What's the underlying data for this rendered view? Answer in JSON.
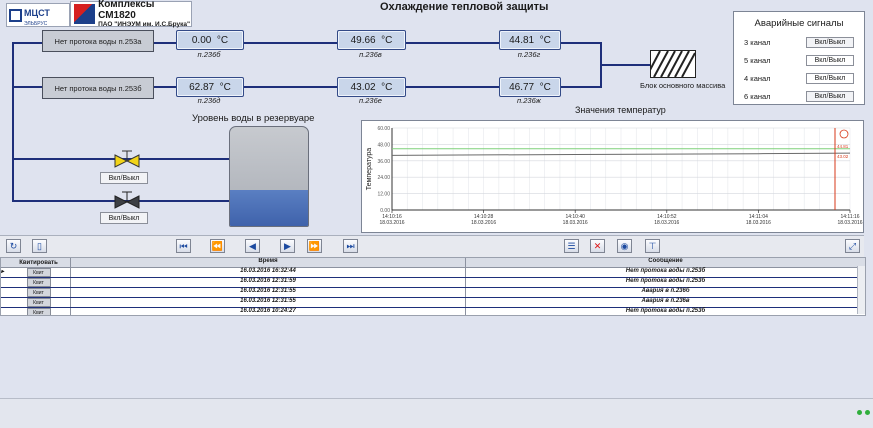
{
  "header": {
    "logo1_main": "МЦСТ",
    "logo1_sub": "ЭЛЬБРУС",
    "logo2_title": "Комплексы СМ1820",
    "logo2_sub": "ПАО \"ИНЭУМ им. И.С.Брука\"",
    "page_title": "Охлаждение тепловой защиты"
  },
  "process": {
    "flow1_label": "Нет протока воды п.253а",
    "flow2_label": "Нет протока воды п.253б",
    "sensors": [
      {
        "value": "0.00",
        "unit": "°C",
        "tag": "п.236б"
      },
      {
        "value": "49.66",
        "unit": "°C",
        "tag": "п.236в"
      },
      {
        "value": "44.81",
        "unit": "°C",
        "tag": "п.236г"
      },
      {
        "value": "62.87",
        "unit": "°C",
        "tag": "п.236д"
      },
      {
        "value": "43.02",
        "unit": "°C",
        "tag": "п.236е"
      },
      {
        "value": "46.77",
        "unit": "°C",
        "tag": "п.236ж"
      }
    ],
    "block_label": "Блок основного массива",
    "valve1_button": "Вкл/Выкл",
    "valve2_button": "Вкл/Выкл",
    "tank_title": "Уровень воды в резервуаре",
    "tank_level_fraction": 0.36
  },
  "alarms": {
    "title": "Аварийные сигналы",
    "rows": [
      {
        "label": "3 канал",
        "button": "Вкл/Выкл"
      },
      {
        "label": "5 канал",
        "button": "Вкл/Выкл"
      },
      {
        "label": "4 канал",
        "button": "Вкл/Выкл"
      },
      {
        "label": "6 канал",
        "button": "Вкл/Выкл"
      }
    ]
  },
  "chart_data": {
    "type": "line",
    "title": "Значения температур",
    "ylabel": "Температура",
    "ylim": [
      0,
      60
    ],
    "yticks": [
      "60.00",
      "48.00",
      "36.00",
      "24.00",
      "12.00",
      "0.00"
    ],
    "xticks": [
      {
        "time": "14:10:16",
        "date": "18.03.2016"
      },
      {
        "time": "14:10:28",
        "date": "18.03.2016"
      },
      {
        "time": "14:10:40",
        "date": "18.03.2016"
      },
      {
        "time": "14:10:52",
        "date": "18.03.2016"
      },
      {
        "time": "14:11:04",
        "date": "18.03.2016"
      },
      {
        "time": "14:11:16",
        "date": "18.03.2016"
      }
    ],
    "series": [
      {
        "color": "#7fd07a",
        "values": [
          44.8,
          44.8,
          44.8,
          44.8,
          44.8,
          44.8
        ]
      },
      {
        "color": "#6a6a6a",
        "values": [
          40.0,
          40.3,
          40.6,
          40.9,
          41.2,
          41.6
        ]
      }
    ],
    "cursor_labels": [
      "44.81",
      "43.02"
    ],
    "cursor_color": "#d83a1a",
    "grid": true
  },
  "toolbar": {
    "refresh_icon": "refresh-icon",
    "doc_icon": "document-icon"
  },
  "events": {
    "headers": {
      "ack": "Квитировать",
      "time": "Время",
      "message": "Сообщение"
    },
    "rows": [
      {
        "ack": "Квит",
        "time": "16.03.2016 16:32:44",
        "message": "Нет протока воды п.253б"
      },
      {
        "ack": "Квит",
        "time": "16.03.2016 12:31:59",
        "message": "Нет протока воды п.253б"
      },
      {
        "ack": "Квит",
        "time": "16.03.2016 12:31:55",
        "message": "Авария в п.236б"
      },
      {
        "ack": "Квит",
        "time": "16.03.2016 12:31:55",
        "message": "Авария в п.236в"
      },
      {
        "ack": "Квит",
        "time": "16.03.2016 10:24:27",
        "message": "Нет протока воды п.253б"
      }
    ]
  }
}
